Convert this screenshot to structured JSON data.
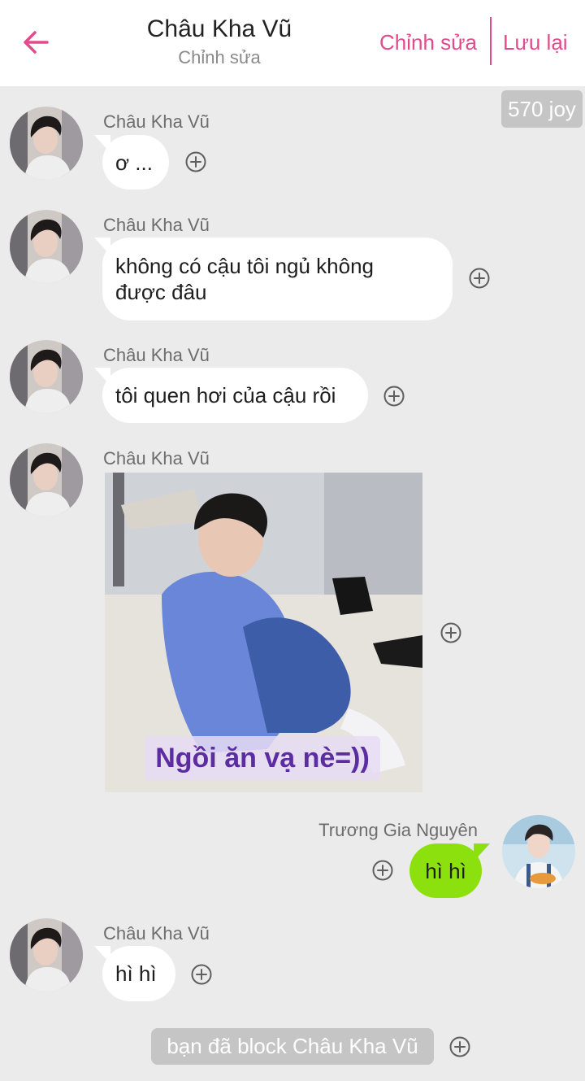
{
  "header": {
    "title": "Châu Kha Vũ",
    "subtitle": "Chỉnh sửa",
    "edit_label": "Chỉnh sửa",
    "save_label": "Lưu lại",
    "accent_color": "#e24a8b"
  },
  "badge": {
    "joy": "570 joy"
  },
  "messages": [
    {
      "sender": "Châu Kha Vũ",
      "text": "ơ ..."
    },
    {
      "sender": "Châu Kha Vũ",
      "lines": [
        "không có cậu tôi ngủ không",
        "được đâu"
      ]
    },
    {
      "sender": "Châu Kha Vũ",
      "text": "tôi quen hơi của cậu rồi"
    },
    {
      "sender": "Châu Kha Vũ",
      "image_caption": "Ngồi ăn vạ nè=))"
    },
    {
      "sender": "Trương Gia Nguyên",
      "text": "hì hì",
      "bubble_color": "#8ce00d"
    },
    {
      "sender": "Châu Kha Vũ",
      "text": "hì hì"
    }
  ],
  "system": {
    "text": "bạn đã block Châu Kha Vũ"
  },
  "icons": {
    "back": "back-arrow-icon",
    "add": "plus-circle-icon"
  }
}
